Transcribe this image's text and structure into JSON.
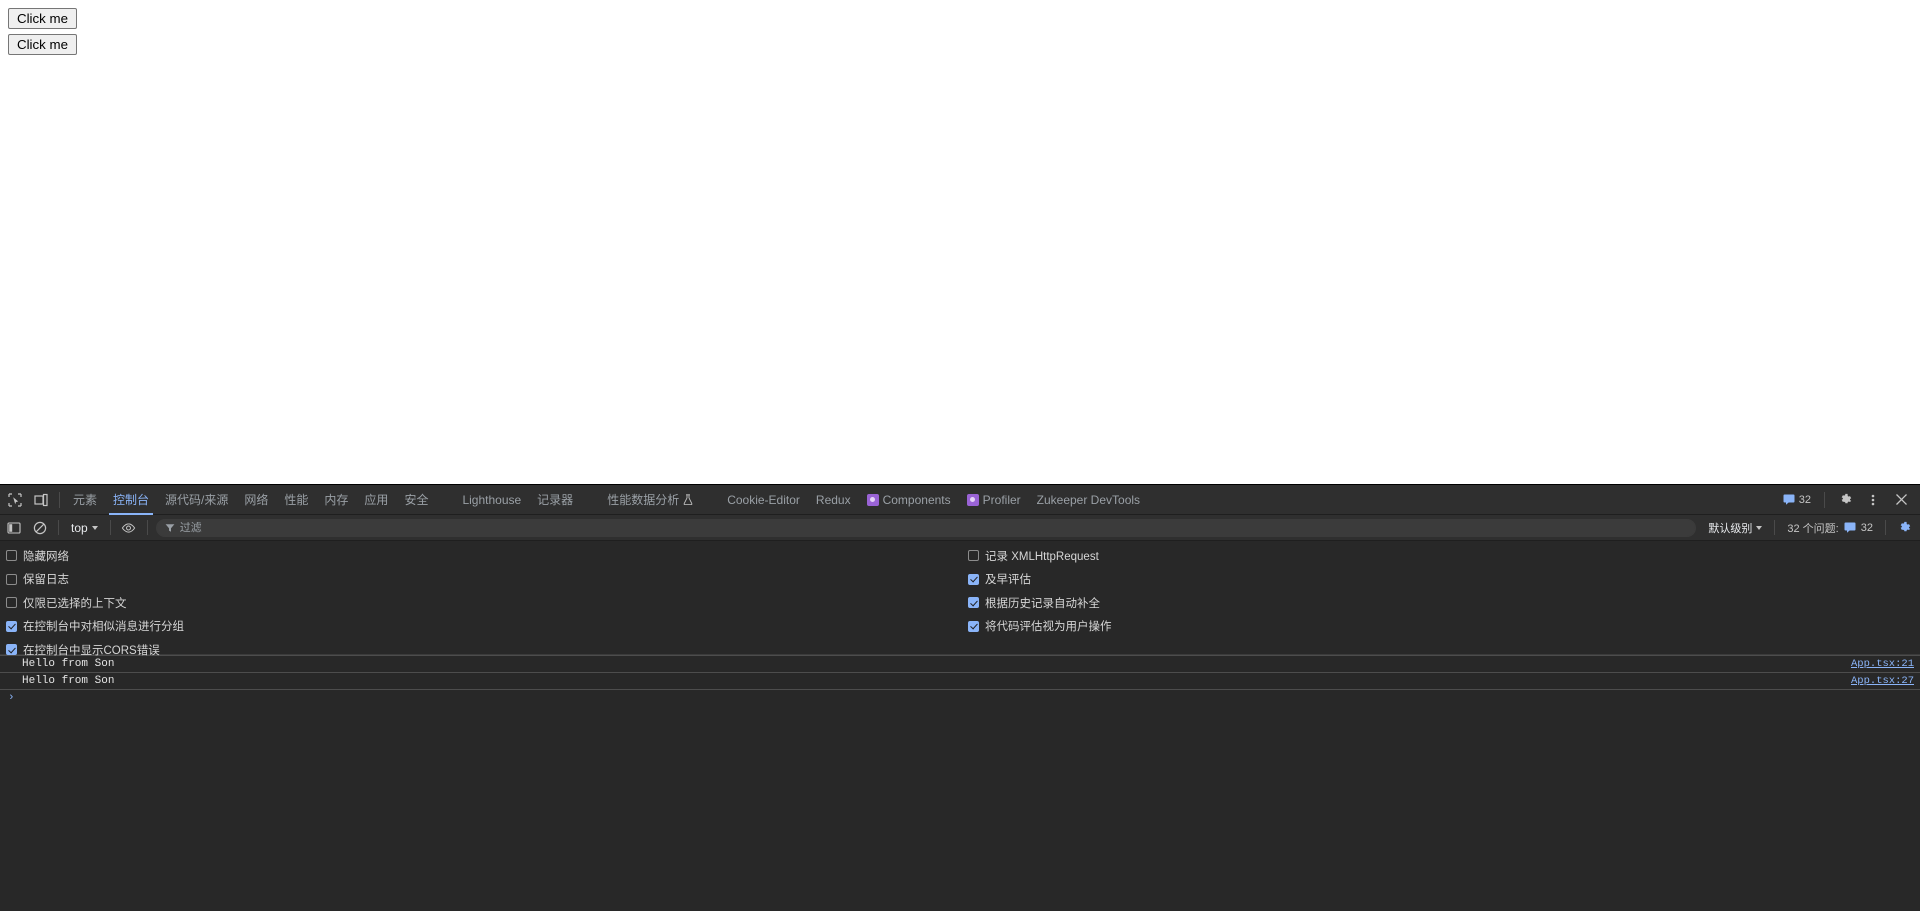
{
  "page": {
    "buttons": [
      {
        "label": "Click me"
      },
      {
        "label": "Click me"
      }
    ]
  },
  "devtools": {
    "left_icons": [
      {
        "name": "inspect-element-icon",
        "title": "检查"
      },
      {
        "name": "device-toolbar-icon",
        "title": "设备工具栏"
      }
    ],
    "tabs": [
      {
        "label": "元素",
        "active": false,
        "icon": null
      },
      {
        "label": "控制台",
        "active": true,
        "icon": null
      },
      {
        "label": "源代码/来源",
        "active": false,
        "icon": null
      },
      {
        "label": "网络",
        "active": false,
        "icon": null
      },
      {
        "label": "性能",
        "active": false,
        "icon": null
      },
      {
        "label": "内存",
        "active": false,
        "icon": null
      },
      {
        "label": "应用",
        "active": false,
        "icon": null
      },
      {
        "label": "安全",
        "active": false,
        "icon": null
      },
      {
        "label": "Lighthouse",
        "active": false,
        "icon": null
      },
      {
        "label": "记录器",
        "active": false,
        "icon": null
      },
      {
        "label": "性能数据分析",
        "active": false,
        "icon": "experiment-icon"
      },
      {
        "label": "Cookie-Editor",
        "active": false,
        "icon": null
      },
      {
        "label": "Redux",
        "active": false,
        "icon": null
      },
      {
        "label": "Components",
        "active": false,
        "icon": "extension-icon"
      },
      {
        "label": "Profiler",
        "active": false,
        "icon": "extension-icon"
      },
      {
        "label": "Zukeeper DevTools",
        "active": false,
        "icon": null
      }
    ],
    "tabbar_right": {
      "issues_count": "32",
      "settings_title": "设置",
      "more_title": "更多选项",
      "close_title": "关闭"
    },
    "console_toolbar": {
      "sidebar_title": "控制台边栏",
      "clear_title": "清空控制台",
      "context": "top",
      "eye_title": "创建实时表达式",
      "filter_placeholder": "过滤",
      "filter_value": "",
      "level": "默认级别",
      "issues_label": "32 个问题:",
      "issues_count": "32",
      "settings_title": "控制台设置"
    },
    "settings": {
      "left": [
        {
          "label": "隐藏网络",
          "checked": false
        },
        {
          "label": "保留日志",
          "checked": false
        },
        {
          "label": "仅限已选择的上下文",
          "checked": false
        },
        {
          "label": "在控制台中对相似消息进行分组",
          "checked": true
        },
        {
          "label": "在控制台中显示CORS错误",
          "checked": true
        }
      ],
      "right": [
        {
          "label": "记录 XMLHttpRequest",
          "checked": false
        },
        {
          "label": "及早评估",
          "checked": true
        },
        {
          "label": "根据历史记录自动补全",
          "checked": true
        },
        {
          "label": "将代码评估视为用户操作",
          "checked": true
        }
      ]
    },
    "messages": [
      {
        "text": "Hello from Son",
        "source": "App.tsx:21"
      },
      {
        "text": "Hello from Son",
        "source": "App.tsx:27"
      }
    ],
    "prompt": {
      "arrow": "›",
      "value": ""
    }
  },
  "colors": {
    "accent_blue": "#8ab4f8",
    "panel_bg": "#282828",
    "toolbar_bg": "#2f2f2f",
    "text": "#e8eaed",
    "extension_purple": "#9a63d6"
  }
}
